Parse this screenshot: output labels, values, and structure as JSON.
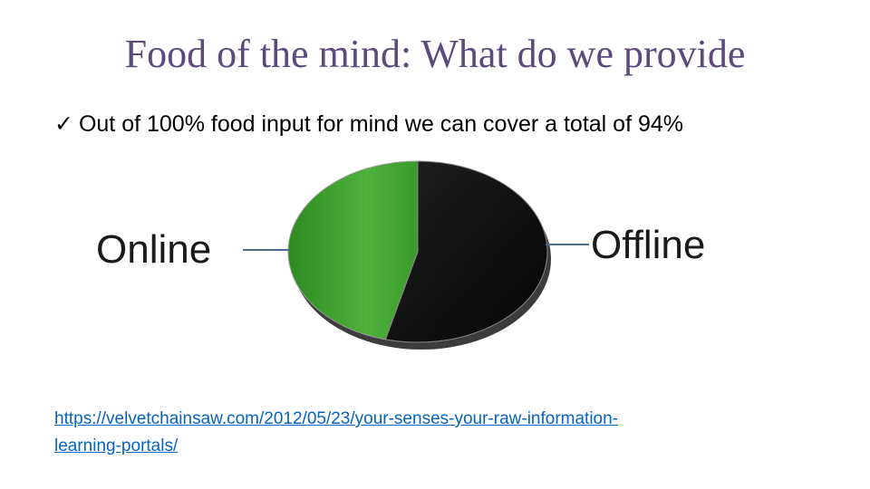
{
  "slide": {
    "title": "Food of the mind: What do we provide",
    "bullet": {
      "icon": "checkmark-icon",
      "text": "Out of 100% food input for mind we can cover a total of 94%"
    },
    "source_link": {
      "line1": "https://velvetchainsaw.com/2012/05/23/your-senses-your-raw-information-",
      "line2": "learning-portals/"
    }
  },
  "chart_data": {
    "type": "pie",
    "categories": [
      "Online",
      "Offline"
    ],
    "values": [
      46,
      54
    ],
    "colors": [
      "#3fa12f",
      "#111111"
    ],
    "title": "",
    "legend": "labels beside slices"
  }
}
